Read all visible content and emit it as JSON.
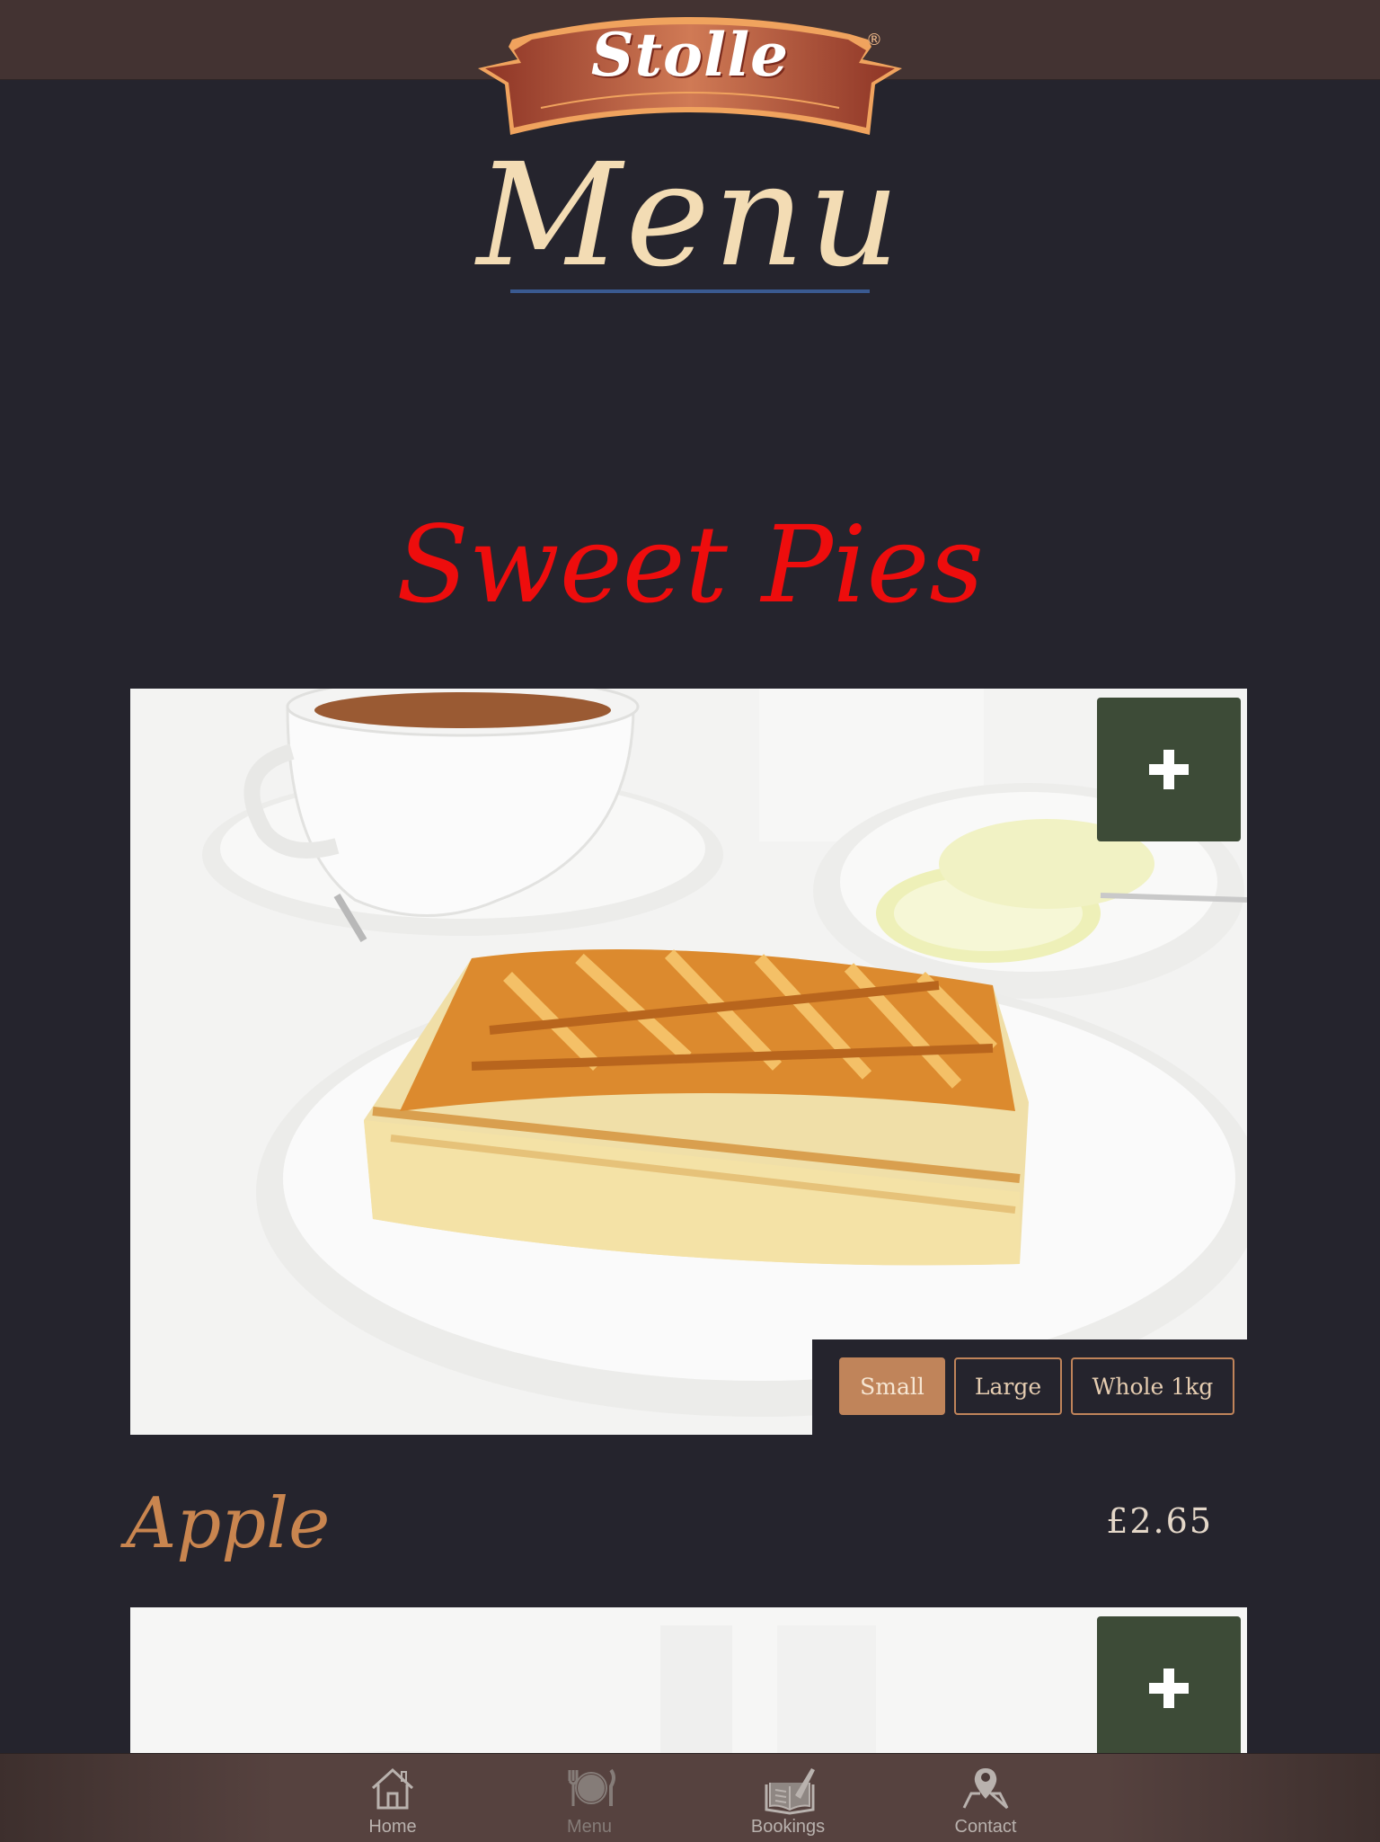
{
  "header": {
    "logo_text": "Stolle",
    "logo_mark": "®"
  },
  "page": {
    "title": "Menu"
  },
  "section": {
    "title": "Sweet Pies"
  },
  "items": [
    {
      "name": "Apple",
      "price": "£2.65",
      "image_icon": "apple-pie-photo",
      "add_icon": "plus-icon",
      "sizes": [
        {
          "label": "Small",
          "selected": true
        },
        {
          "label": "Large",
          "selected": false
        },
        {
          "label": "Whole 1kg",
          "selected": false
        }
      ]
    },
    {
      "image_icon": "pie-photo",
      "add_icon": "plus-icon"
    }
  ],
  "tabs": [
    {
      "label": "Home",
      "icon": "home-icon"
    },
    {
      "label": "Menu",
      "icon": "plate-cutlery-icon",
      "current": true
    },
    {
      "label": "Bookings",
      "icon": "book-pen-icon"
    },
    {
      "label": "Contact",
      "icon": "map-pin-icon"
    }
  ],
  "colors": {
    "background": "#25242d",
    "header_bar": "#433332",
    "title": "#f3dcb4",
    "section_title": "#ee0d0d",
    "item_name": "#c9854f",
    "accent_button": "#c0845a",
    "add_button": "#3d4b37"
  }
}
